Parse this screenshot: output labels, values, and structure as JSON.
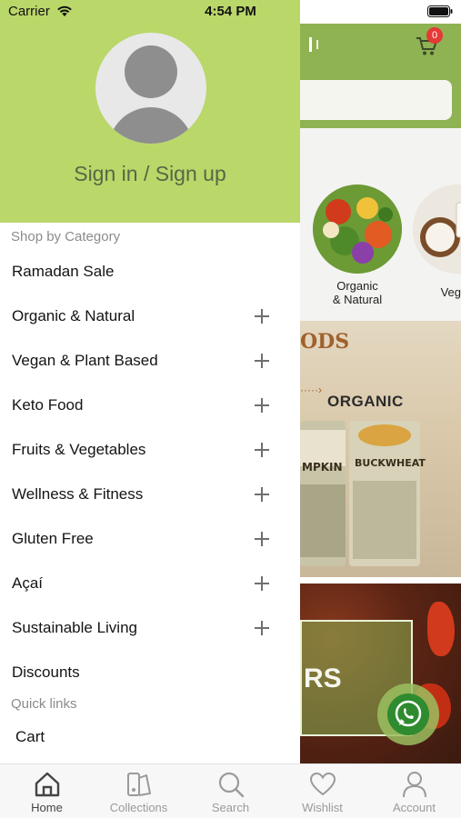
{
  "status_bar": {
    "carrier": "Carrier",
    "time": "4:54 PM"
  },
  "background_page": {
    "cart_count": "0",
    "categories": [
      {
        "label_line1": "Organic",
        "label_line2": "& Natural"
      },
      {
        "label_line1": "Vegan",
        "label_line2": ""
      }
    ],
    "banner_title": "ODS",
    "banner_subtitle": "ORGANIC",
    "pack_left": "MPKIN",
    "pack_right": "BUCKWHEAT",
    "spices_text": "RS",
    "brand_color": "#8fb253"
  },
  "drawer": {
    "sign_in_label": "Sign in / Sign up",
    "header_color": "#bad76a",
    "shop_by_category_label": "Shop by Category",
    "categories": [
      {
        "label": "Ramadan Sale",
        "expandable": false
      },
      {
        "label": "Organic & Natural",
        "expandable": true
      },
      {
        "label": "Vegan & Plant Based",
        "expandable": true
      },
      {
        "label": "Keto Food",
        "expandable": true
      },
      {
        "label": "Fruits & Vegetables",
        "expandable": true
      },
      {
        "label": "Wellness & Fitness",
        "expandable": true
      },
      {
        "label": "Gluten Free",
        "expandable": true
      },
      {
        "label": "Açaí",
        "expandable": true
      },
      {
        "label": "Sustainable Living",
        "expandable": true
      },
      {
        "label": "Discounts",
        "expandable": false
      }
    ],
    "quick_links_label": "Quick links",
    "quick_links": [
      {
        "label": "Cart"
      }
    ]
  },
  "tab_bar": {
    "tabs": [
      {
        "label": "Home",
        "icon": "home-icon",
        "active": true
      },
      {
        "label": "Collections",
        "icon": "collections-icon",
        "active": false
      },
      {
        "label": "Search",
        "icon": "search-icon",
        "active": false
      },
      {
        "label": "Wishlist",
        "icon": "heart-icon",
        "active": false
      },
      {
        "label": "Account",
        "icon": "account-icon",
        "active": false
      }
    ]
  }
}
